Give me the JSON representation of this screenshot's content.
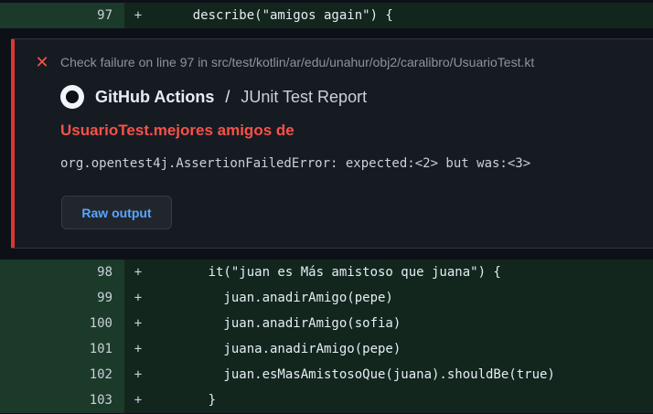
{
  "diff_top": {
    "line": "97",
    "sign": "+",
    "code": "    describe(\"amigos again\") {"
  },
  "annotation": {
    "icon": "x-icon",
    "title": "Check failure on line 97 in src/test/kotlin/ar/edu/unahur/obj2/caralibro/UsuarioTest.kt",
    "source_app": "GitHub Actions",
    "source_sep": "/",
    "source_check": "JUnit Test Report",
    "error_title": "UsuarioTest.mejores amigos de",
    "error_message": "org.opentest4j.AssertionFailedError: expected:<2> but was:<3>",
    "raw_output_label": "Raw output",
    "accent_color": "#da3633",
    "link_color": "#58a6ff"
  },
  "diff_rows": [
    {
      "line": "98",
      "sign": "+",
      "code": "      it(\"juan es Más amistoso que juana\") {"
    },
    {
      "line": "99",
      "sign": "+",
      "code": "        juan.anadirAmigo(pepe)"
    },
    {
      "line": "100",
      "sign": "+",
      "code": "        juan.anadirAmigo(sofia)"
    },
    {
      "line": "101",
      "sign": "+",
      "code": "        juana.anadirAmigo(pepe)"
    },
    {
      "line": "102",
      "sign": "+",
      "code": "        juan.esMasAmistosoQue(juana).shouldBe(true)"
    },
    {
      "line": "103",
      "sign": "+",
      "code": "      }"
    }
  ]
}
